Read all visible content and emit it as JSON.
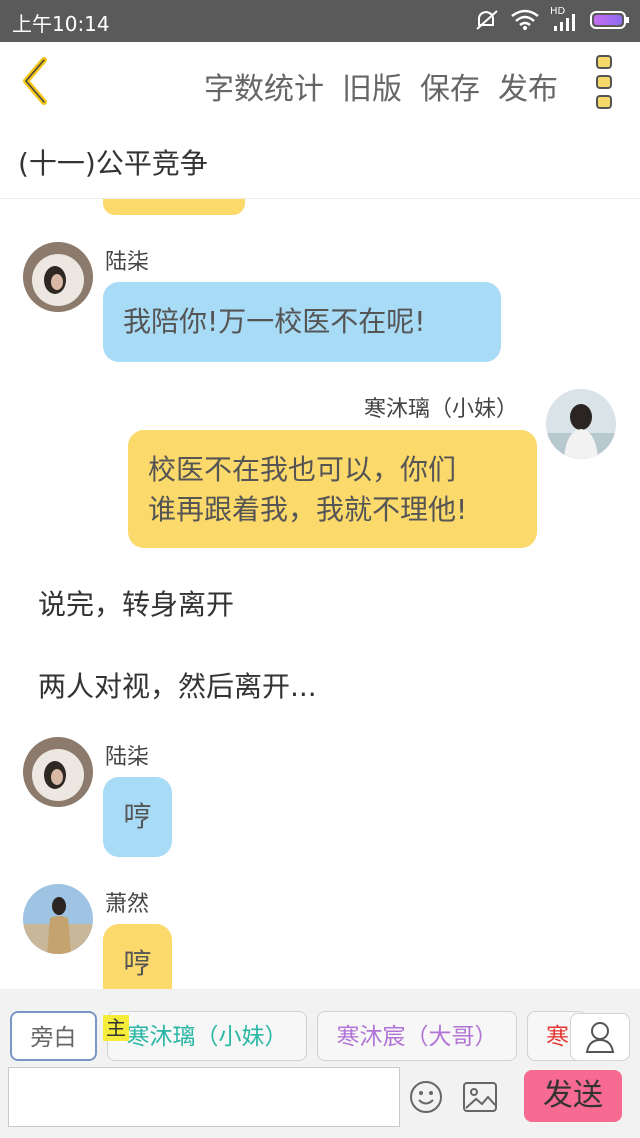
{
  "status_bar": {
    "time": "上午10:14",
    "network": "HD"
  },
  "toolbar": {
    "word_count": "字数统计",
    "old_version": "旧版",
    "save": "保存",
    "publish": "发布"
  },
  "chapter": {
    "title": "(十一)公平竞争"
  },
  "messages": [
    {
      "speaker": "陆柒",
      "text": "我陪你!万一校医不在呢!"
    },
    {
      "speaker": "寒沐璃（小妹）",
      "text_line1": "校医不在我也可以，你们",
      "text_line2": "谁再跟着我，我就不理他!"
    },
    {
      "narration": "说完，转身离开"
    },
    {
      "narration": "两人对视，然后离开..."
    },
    {
      "speaker": "陆柒",
      "text": "哼"
    },
    {
      "speaker": "萧然",
      "text": "哼"
    }
  ],
  "roles": [
    {
      "label": "旁白",
      "color": "#666666"
    },
    {
      "label": "寒沐璃（小妹）",
      "color": "#2bb7a6",
      "badge": "主"
    },
    {
      "label": "寒沐宸（大哥）",
      "color": "#b275d6"
    },
    {
      "label": "寒",
      "color": "#e53935"
    }
  ],
  "composer": {
    "send_label": "发送"
  },
  "colors": {
    "blue_bubble": "#a8dbf6",
    "yellow_bubble": "#fbd96b",
    "send_button": "#f76a92",
    "accent": "#f5c518"
  }
}
